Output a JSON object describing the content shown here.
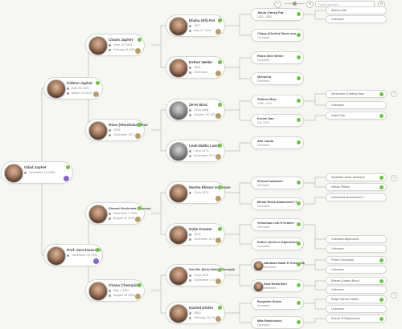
{
  "toolbar": {
    "search_placeholder": "Find a person...",
    "zoom_minus": "−",
    "zoom_plus": "+",
    "zoom_reset": "⊙"
  },
  "people": {
    "root": {
      "name": "Gilad Japhet",
      "l1": "December 18 1969",
      "l2": ""
    },
    "gideon": {
      "name": "Gideon Japhet",
      "l1": "July 26 1929",
      "l2": "March 18 2013"
    },
    "chaim": {
      "name": "Chaim Japhet",
      "l1": "June 19 1903",
      "l2": "February 8 1990"
    },
    "rosa": {
      "name": "Rosa (Shoshana) Braz",
      "l1": "1906",
      "l2": "December 25 1987"
    },
    "eliahu": {
      "name": "Eliahu (Eli) Pat",
      "l1": "1857",
      "l2": "May 27 1942"
    },
    "esther": {
      "name": "Esther Weiler",
      "l1": "1876",
      "l2": "Deceased"
    },
    "zeev": {
      "name": "Ze'ev Braz",
      "l1": "Circa 1868",
      "l2": "October 29 1935"
    },
    "leah": {
      "name": "Leah Malka Landa",
      "l1": "Circa 1873",
      "l2": "November 15 1943"
    },
    "sara": {
      "name": "Prof. Sara Isaacson",
      "l1": "November 18 1934",
      "l2": ""
    },
    "shmuel_n": {
      "name": "Shmuel Nechemia Isaacson",
      "l1": "November 1 1902",
      "l2": "August 16 1978"
    },
    "chana": {
      "name": "Chana Cheznjnik",
      "l1": "May 1 1911",
      "l2": "August 15 1996"
    },
    "moshe": {
      "name": "Moshe Eliezer Isaacson",
      "l1": "Circa 1870",
      "l2": ""
    },
    "dobe": {
      "name": "Dobe Kramer",
      "l1": "1875",
      "l2": "November 26 1960"
    },
    "dov": {
      "name": "Dov Ber (Bert) Hatsel Cheznjnik",
      "l1": "Circa 1878",
      "l2": "September 1 1957"
    },
    "rachel": {
      "name": "Rachel Diskin",
      "l1": "1880",
      "l2": "February 16 1959"
    }
  },
  "grand": [
    {
      "name": "Jacob (Yankl) Pat",
      "l1": "1823 - 1883"
    },
    {
      "name": "Chaya (Cheike) Stone oon",
      "l1": "Deceased"
    },
    {
      "name": "Robin Meir Weiler",
      "l1": "Deceased"
    },
    {
      "name": "Menucha",
      "l1": "Deceased"
    },
    {
      "name": "Shimon Braz",
      "l1": "1838 - 1913"
    },
    {
      "name": "Kreine Dan",
      "l1": "Dec 1903"
    },
    {
      "name": "Abe Landa",
      "l1": "Deceased"
    },
    {
      "name": "Shmuel Isaacson",
      "l1": "Deceased"
    },
    {
      "name": "Minah Rivka Abamovich??",
      "l1": "Deceased"
    },
    {
      "name": "Yehoshua Leib H Kramer",
      "l1": "Deceased"
    },
    {
      "name": "Esther (Asha or Alperovich",
      "l1": "Deceased"
    },
    {
      "name": "Abraham Isaac H Cheznjnik",
      "l1": "Deceased"
    },
    {
      "name": "Sara Nesia Borl",
      "l1": "Deceased"
    },
    {
      "name": "Benjamin Diskin",
      "l1": "Deceased"
    },
    {
      "name": "Mila Rabinowich",
      "l1": "Deceased"
    }
  ],
  "far": [
    {
      "name": "Aishon Hat"
    },
    {
      "name": "Unknown"
    },
    {
      "name": "Alexander (Zaldon) Braz"
    },
    {
      "name": "Unknown"
    },
    {
      "name": "Israel Dan"
    },
    {
      "name": "Abraham Isaac Isaacson"
    },
    {
      "name": "Miriam Rilkes"
    },
    {
      "name": "Nechemia Abamovich??"
    },
    {
      "name": "Unknown Alperovich"
    },
    {
      "name": "Unknown"
    },
    {
      "name": "Fiebel Cheznjnik"
    },
    {
      "name": "Unknown"
    },
    {
      "name": "Eliezer (Lazer) Burni"
    },
    {
      "name": "Unknown"
    },
    {
      "name": "Raiph Zarach Diskin"
    },
    {
      "name": "Unknown"
    },
    {
      "name": "Eliezer B Rabinowich"
    }
  ],
  "expand_glyph": "›"
}
